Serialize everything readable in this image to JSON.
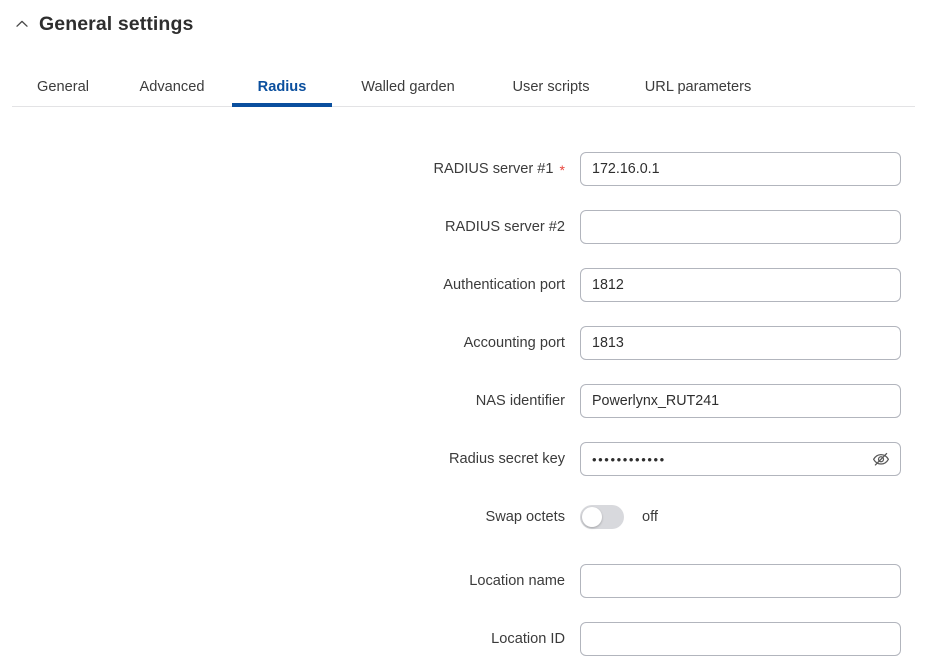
{
  "header": {
    "collapse_icon": "chevron-up-icon",
    "title": "General settings"
  },
  "tabs": {
    "active_index": 2,
    "accent_color": "#0a4f9e",
    "items": [
      {
        "label": "General"
      },
      {
        "label": "Advanced"
      },
      {
        "label": "Radius"
      },
      {
        "label": "Walled garden"
      },
      {
        "label": "User scripts"
      },
      {
        "label": "URL parameters"
      }
    ]
  },
  "form": {
    "required_marker": "*",
    "required_marker_color": "#e8453c",
    "fields": [
      {
        "label": "RADIUS server #1",
        "required": true,
        "type": "text",
        "value": "172.16.0.1",
        "placeholder": ""
      },
      {
        "label": "RADIUS server #2",
        "required": false,
        "type": "text",
        "value": "",
        "placeholder": ""
      },
      {
        "label": "Authentication port",
        "required": false,
        "type": "text",
        "value": "1812",
        "placeholder": ""
      },
      {
        "label": "Accounting port",
        "required": false,
        "type": "text",
        "value": "1813",
        "placeholder": ""
      },
      {
        "label": "NAS identifier",
        "required": false,
        "type": "text",
        "value": "Powerlynx_RUT241",
        "placeholder": ""
      },
      {
        "label": "Radius secret key",
        "required": false,
        "type": "password",
        "value": "••••••••••••",
        "placeholder": "",
        "reveal_icon": "eye-slash-icon"
      },
      {
        "label": "Swap octets",
        "required": false,
        "type": "toggle",
        "state": "off",
        "state_label": "off"
      },
      {
        "label": "Location name",
        "required": false,
        "type": "text",
        "value": "",
        "placeholder": ""
      },
      {
        "label": "Location ID",
        "required": false,
        "type": "text",
        "value": "",
        "placeholder": ""
      }
    ]
  }
}
